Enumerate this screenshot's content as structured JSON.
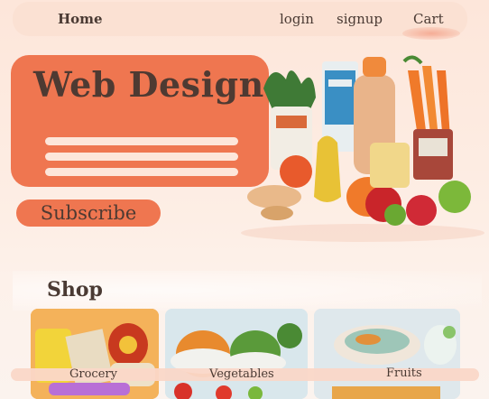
{
  "nav": {
    "home": "Home",
    "login": "login",
    "signup": "signup",
    "cart": "Cart"
  },
  "hero": {
    "title": "Web Design",
    "subscribe_label": "Subscribe"
  },
  "shop": {
    "title": "Shop",
    "categories": [
      {
        "label": "Grocery"
      },
      {
        "label": "Vegetables"
      },
      {
        "label": "Fruits"
      }
    ]
  },
  "colors": {
    "accent": "#ef7650",
    "background": "#fde6da",
    "text": "#4a3a33"
  }
}
